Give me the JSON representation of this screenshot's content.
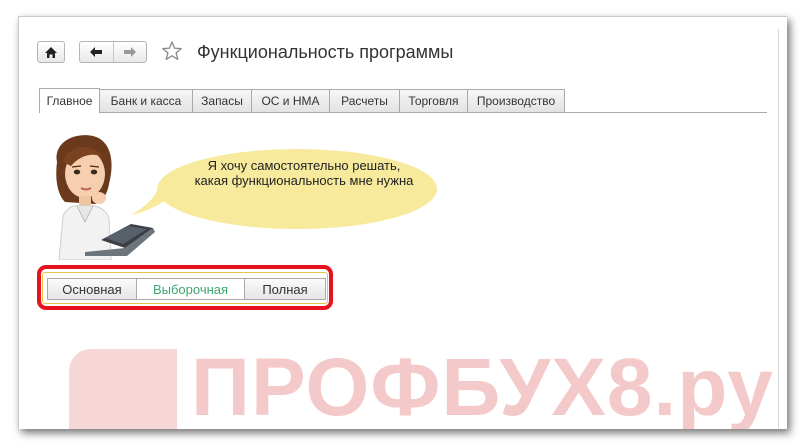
{
  "window": {
    "title": "Функциональность программы"
  },
  "toolbar": {
    "home_icon": "home-icon",
    "back_icon": "arrow-left-icon",
    "forward_icon": "arrow-right-icon",
    "favorite_icon": "star-icon"
  },
  "tabs": [
    {
      "label": "Главное",
      "active": true
    },
    {
      "label": "Банк и касса",
      "active": false
    },
    {
      "label": "Запасы",
      "active": false
    },
    {
      "label": "ОС и НМА",
      "active": false
    },
    {
      "label": "Расчеты",
      "active": false
    },
    {
      "label": "Торговля",
      "active": false
    },
    {
      "label": "Производство",
      "active": false
    }
  ],
  "assistant": {
    "speech_line1": "Я хочу самостоятельно решать,",
    "speech_line2": "какая функциональность мне нужна",
    "bubble_color": "#f7ea9c"
  },
  "mode_selector": {
    "options": [
      "Основная",
      "Выборочная",
      "Полная"
    ],
    "selected": "Выборочная",
    "highlight_color": "#e8121e",
    "selected_text_color": "#3aa76d"
  },
  "watermark": {
    "text": "ПРОФБУХ8.ру",
    "color": "#f4c9c9"
  }
}
